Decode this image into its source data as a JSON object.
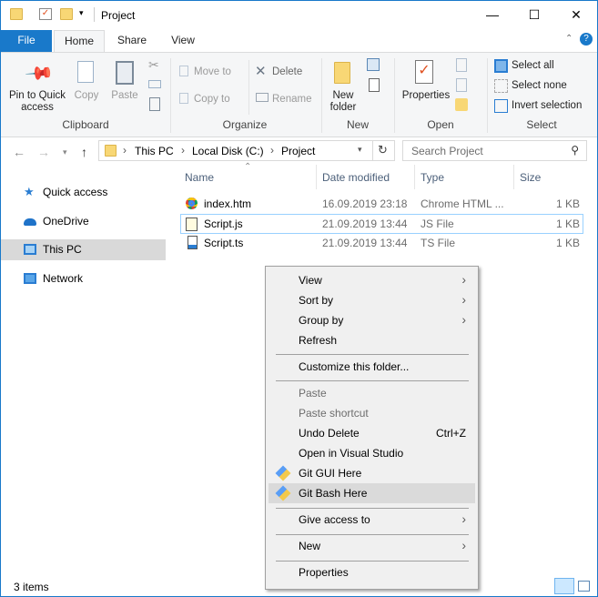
{
  "window": {
    "title": "Project",
    "controls": {
      "minimize": "—",
      "maximize": "☐",
      "close": "✕"
    }
  },
  "tabs": [
    "File",
    "Home",
    "Share",
    "View"
  ],
  "ribbon": {
    "clipboard": {
      "pin": "Pin to Quick access",
      "copy": "Copy",
      "paste": "Paste",
      "group": "Clipboard"
    },
    "organize": {
      "move_to": "Move to",
      "copy_to": "Copy to",
      "delete": "Delete",
      "rename": "Rename",
      "group": "Organize"
    },
    "new": {
      "new_folder": "New folder",
      "group": "New"
    },
    "open": {
      "properties": "Properties",
      "group": "Open"
    },
    "select": {
      "select_all": "Select all",
      "select_none": "Select none",
      "invert": "Invert selection",
      "group": "Select"
    }
  },
  "address": {
    "crumbs": [
      "This PC",
      "Local Disk (C:)",
      "Project"
    ],
    "search_placeholder": "Search Project"
  },
  "nav": [
    {
      "label": "Quick access",
      "icon": "star-icon"
    },
    {
      "label": "OneDrive",
      "icon": "cloud-icon"
    },
    {
      "label": "This PC",
      "icon": "computer-icon",
      "selected": true
    },
    {
      "label": "Network",
      "icon": "network-icon"
    }
  ],
  "columns": [
    "Name",
    "Date modified",
    "Type",
    "Size"
  ],
  "files": [
    {
      "name": "index.htm",
      "date": "16.09.2019 23:18",
      "type": "Chrome HTML ...",
      "size": "1 KB",
      "icon": "chrome-icon"
    },
    {
      "name": "Script.js",
      "date": "21.09.2019 13:44",
      "type": "JS File",
      "size": "1 KB",
      "icon": "js-file-icon",
      "selected": true
    },
    {
      "name": "Script.ts",
      "date": "21.09.2019 13:44",
      "type": "TS File",
      "size": "1 KB",
      "icon": "ts-file-icon"
    }
  ],
  "status": {
    "items": "3 items"
  },
  "context_menu": {
    "view": "View",
    "sort_by": "Sort by",
    "group_by": "Group by",
    "refresh": "Refresh",
    "customize": "Customize this folder...",
    "paste": "Paste",
    "paste_shortcut": "Paste shortcut",
    "undo_delete": "Undo Delete",
    "undo_shortcut": "Ctrl+Z",
    "open_vs": "Open in Visual Studio",
    "git_gui": "Git GUI Here",
    "git_bash": "Git Bash Here",
    "give_access": "Give access to",
    "new": "New",
    "properties": "Properties",
    "arrow": "›"
  },
  "colors": {
    "accent": "#1979ca",
    "selection": "#cce8ff",
    "menu_highlight": "#dadada"
  }
}
